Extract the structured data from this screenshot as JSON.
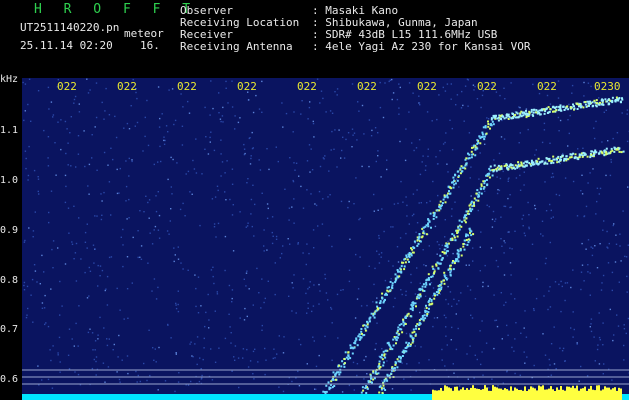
{
  "header": {
    "brand": "H R O F F T",
    "filename": "UT2511140220.pn",
    "tag": "meteor",
    "datetime": "25.11.14 02:20",
    "count": "16.",
    "fields": [
      {
        "label": "Observer",
        "value": ": Masaki Kano"
      },
      {
        "label": "Receiving Location",
        "value": ": Shibukawa, Gunma, Japan"
      },
      {
        "label": "Receiver",
        "value": ": SDR# 43dB L15 111.6MHz USB"
      },
      {
        "label": "Receiving Antenna",
        "value": ": 4ele Yagi Az 230 for Kansai VOR"
      }
    ]
  },
  "axis": {
    "unit": "kHz",
    "y_ticks": [
      "1.1",
      "1.0",
      "0.9",
      "0.8",
      "0.7",
      "0.6"
    ],
    "x_ticks": [
      "022",
      "022",
      "022",
      "022",
      "022",
      "022",
      "022",
      "022",
      "022",
      "0230"
    ]
  },
  "colors": {
    "background": "#0a1460",
    "trace": "#6fd6ff",
    "bright": "#ffff40",
    "baseline": "#00e5ff"
  }
}
